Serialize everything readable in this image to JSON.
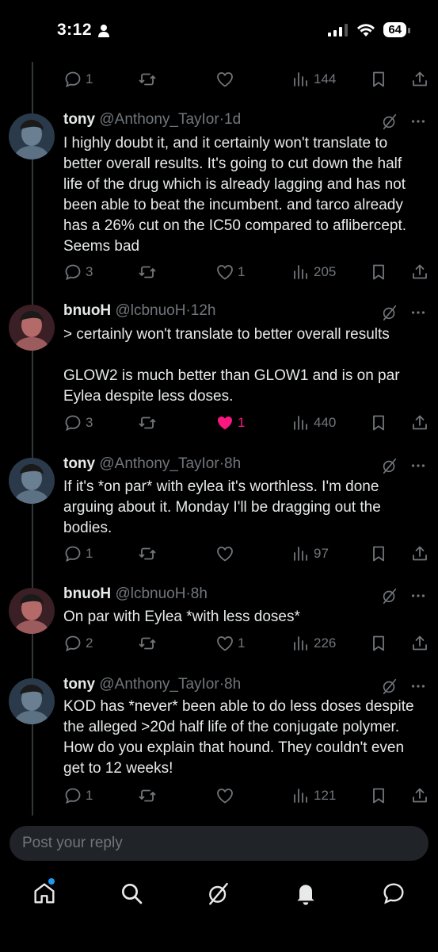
{
  "status_bar": {
    "time": "3:12",
    "battery": "64"
  },
  "top_actions": {
    "replies": "1",
    "reposts": "",
    "likes": "",
    "views": "144"
  },
  "tweets": [
    {
      "name": "tony",
      "handle": "@Anthony_TayIor",
      "age": "1d",
      "body": "I highly doubt it, and it certainly won't translate to better overall results. It's going to cut down the half life of the drug which is already lagging and has not been able to beat the incumbent. and tarco already has a 26% cut on the IC50 compared to aflibercept. Seems bad",
      "replies": "3",
      "reposts": "",
      "likes": "1",
      "views": "205",
      "liked": false
    },
    {
      "name": "bnuoH",
      "handle": "@lcbnuoH",
      "age": "12h",
      "body": "> certainly won't translate to better overall results\n\nGLOW2 is much better than GLOW1 and is on par Eylea despite less doses.",
      "replies": "3",
      "reposts": "",
      "likes": "1",
      "views": "440",
      "liked": true
    },
    {
      "name": "tony",
      "handle": "@Anthony_TayIor",
      "age": "8h",
      "body": "If it's *on par* with eylea it's worthless. I'm done arguing about it. Monday I'll be dragging out the bodies.",
      "replies": "1",
      "reposts": "",
      "likes": "",
      "views": "97",
      "liked": false
    },
    {
      "name": "bnuoH",
      "handle": "@lcbnuoH",
      "age": "8h",
      "body": "On par with Eylea *with less doses*",
      "replies": "2",
      "reposts": "",
      "likes": "1",
      "views": "226",
      "liked": false
    },
    {
      "name": "tony",
      "handle": "@Anthony_TayIor",
      "age": "8h",
      "body": "KOD has *never* been able to do less doses despite the alleged >20d half life of the conjugate polymer. How do you explain that hound. They couldn't even get to 12 weeks!",
      "replies": "1",
      "reposts": "",
      "likes": "",
      "views": "121",
      "liked": false
    }
  ],
  "reply_box": {
    "placeholder": "Post your reply"
  },
  "nav": [
    "home-icon",
    "search-icon",
    "grok-icon",
    "notifications-icon",
    "messages-icon"
  ],
  "colors": {
    "background": "#000000",
    "text": "#e7e9ea",
    "muted": "#71767b",
    "like": "#f91880",
    "accent": "#1d9bf0"
  }
}
